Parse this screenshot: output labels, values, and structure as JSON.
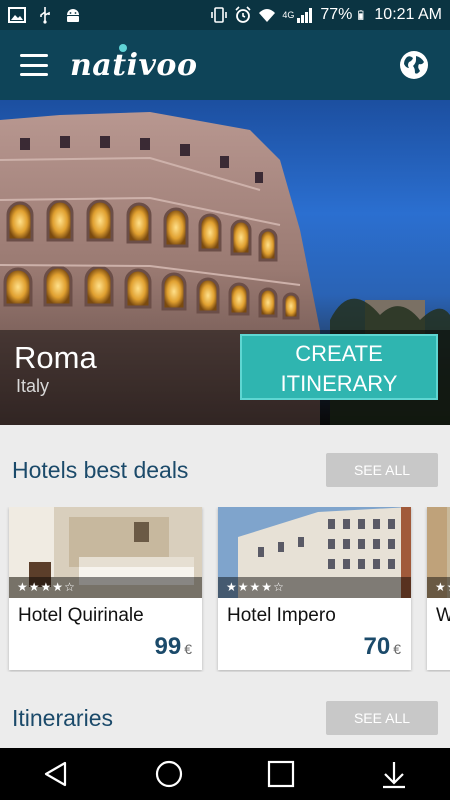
{
  "status_bar": {
    "battery": "77%",
    "time": "10:21 AM",
    "network": "4G",
    "icons": [
      "image-icon",
      "usb-icon",
      "android-icon",
      "vibrate-icon",
      "alarm-icon",
      "wifi-icon",
      "signal-icon",
      "battery-icon"
    ]
  },
  "app_bar": {
    "logo": "nativoo",
    "icons": [
      "menu-icon",
      "globe-icon"
    ]
  },
  "hero": {
    "city": "Roma",
    "country": "Italy",
    "cta_line1": "CREATE",
    "cta_line2": "ITINERARY"
  },
  "hotels_section": {
    "title": "Hotels best deals",
    "see_all": "SEE ALL",
    "hotels": [
      {
        "name": "Hotel Quirinale",
        "price": "99",
        "currency": "€",
        "stars": 4
      },
      {
        "name": "Hotel Impero",
        "price": "70",
        "currency": "€",
        "stars": 4
      },
      {
        "name": "W",
        "price": "",
        "currency": "",
        "stars": 4
      }
    ]
  },
  "itineraries_section": {
    "title": "Itineraries",
    "see_all": "SEE ALL"
  },
  "nav_bar": {
    "icons": [
      "back-icon",
      "home-icon",
      "recents-icon",
      "download-icon"
    ]
  },
  "colors": {
    "status_bar": "#0b3442",
    "app_bar": "#0e4458",
    "accent": "#2fb5b0",
    "title_text": "#1b4a6a",
    "button_gray": "#c8c8c8"
  }
}
